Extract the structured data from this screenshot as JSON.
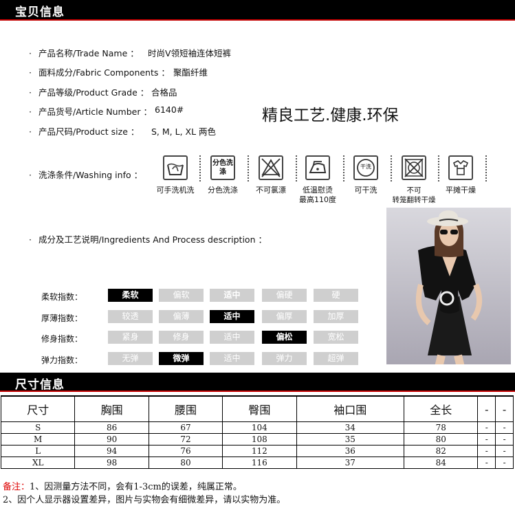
{
  "section1": {
    "title": "宝贝信息"
  },
  "info": [
    {
      "label": "产品名称/Trade Name ：",
      "value": "时尚V领短袖连体短裤"
    },
    {
      "label": "面料成分/Fabric Components ：",
      "value": "聚酯纤维"
    },
    {
      "label": "产品等级/Product Grade ：",
      "value": "合格品"
    },
    {
      "label": "产品货号/Article Number ：",
      "value": "6140#"
    },
    {
      "label": "产品尺码/Product size ：",
      "value": "S, M, L, XL   两色"
    }
  ],
  "bullet": "·",
  "slogan": "精良工艺.健康.环保",
  "washing": {
    "label": "洗涤条件/Washing info ：",
    "items": [
      {
        "name": "hand-wash-icon",
        "text": "可手洗机洗"
      },
      {
        "name": "wash-separately-icon",
        "text": "分色洗涤",
        "icon_text": "分色洗涤"
      },
      {
        "name": "no-bleach-icon",
        "text": "不可氯漂"
      },
      {
        "name": "low-iron-icon",
        "text": "低温慰烫\n最高110度"
      },
      {
        "name": "dry-clean-icon",
        "text": "可干洗",
        "icon_text": "干洗"
      },
      {
        "name": "no-tumble-dry-icon",
        "text": "不可\n转笼翻转干燥"
      },
      {
        "name": "flat-dry-icon",
        "text": "平摊干燥"
      }
    ]
  },
  "process": {
    "label": "成分及工艺说明/Ingredients And Process description ："
  },
  "indices": [
    {
      "label": "柔软指数：",
      "options": [
        "柔软",
        "偏软",
        "适中",
        "偏硬",
        "硬"
      ],
      "selected": 0
    },
    {
      "label": "厚薄指数：",
      "options": [
        "较透",
        "偏薄",
        "适中",
        "偏厚",
        "加厚"
      ],
      "selected": 2
    },
    {
      "label": "修身指数：",
      "options": [
        "紧身",
        "修身",
        "适中",
        "偏松",
        "宽松"
      ],
      "selected": 3
    },
    {
      "label": "弹力指数：",
      "options": [
        "无弹",
        "微弹",
        "适中",
        "弹力",
        "超弹"
      ],
      "selected": 1
    }
  ],
  "section2": {
    "title": "尺寸信息"
  },
  "size_table": {
    "headers": [
      "尺寸",
      "胸围",
      "腰围",
      "臀围",
      "袖口围",
      "全长",
      "-",
      "-"
    ],
    "rows": [
      [
        "S",
        "86",
        "67",
        "104",
        "34",
        "78",
        "-",
        "-"
      ],
      [
        "M",
        "90",
        "72",
        "108",
        "35",
        "80",
        "-",
        "-"
      ],
      [
        "L",
        "94",
        "76",
        "112",
        "36",
        "82",
        "-",
        "-"
      ],
      [
        "XL",
        "98",
        "80",
        "116",
        "37",
        "84",
        "-",
        "-"
      ]
    ]
  },
  "notes": {
    "prefix": "备注：",
    "line1": "1、因测量方法不同，会有1-3cm的误差，纯属正常。",
    "line2": "2、因个人显示器设置差异，图片与实物会有细微差异，请以实物为准。"
  },
  "colors": {
    "accent": "#c40000",
    "chip_on": "#000000",
    "chip_off": "#cfcfcf",
    "note_red": "#dd0000"
  }
}
